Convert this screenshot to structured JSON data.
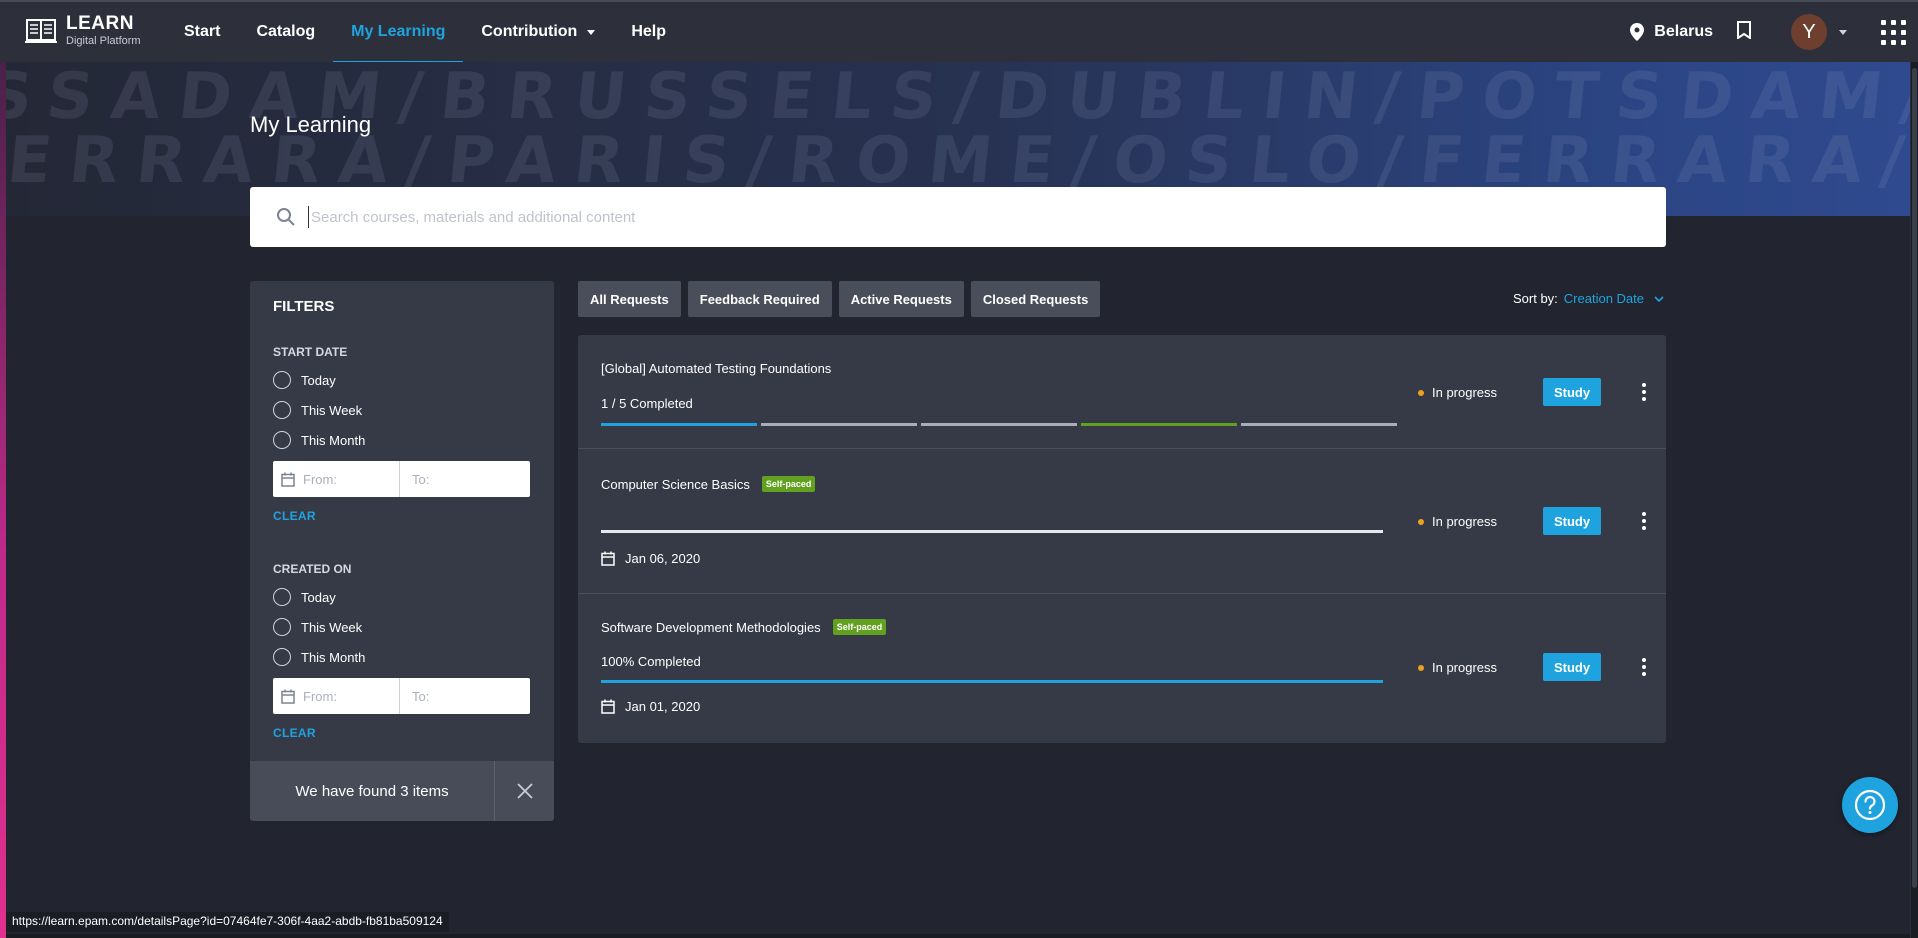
{
  "header": {
    "logo_title": "LEARN",
    "logo_subtitle": "Digital Platform",
    "nav": [
      {
        "label": "Start"
      },
      {
        "label": "Catalog"
      },
      {
        "label": "My Learning",
        "active": true
      },
      {
        "label": "Contribution",
        "dropdown": true
      },
      {
        "label": "Help"
      }
    ],
    "location": "Belarus",
    "avatar_initial": "Y",
    "accent_color": "#1fa3de"
  },
  "banner": {
    "row1": "SSADAM/BRUSSELS/DUBLIN/POTSDAM/BRUSSELS/DUBLIN",
    "row2": "FERRARA/PARIS/ROME/OSLO/FERRARA/PARIS/ROME"
  },
  "page": {
    "title": "My Learning"
  },
  "search": {
    "placeholder": "Search courses, materials and additional content",
    "value": ""
  },
  "filters": {
    "title": "FILTERS",
    "start_date": {
      "label": "START DATE",
      "options": [
        "Today",
        "This Week",
        "This Month"
      ],
      "from_placeholder": "From:",
      "to_placeholder": "To:",
      "clear": "CLEAR"
    },
    "created_on": {
      "label": "CREATED ON",
      "options": [
        "Today",
        "This Week",
        "This Month"
      ],
      "from_placeholder": "From:",
      "to_placeholder": "To:",
      "clear": "CLEAR"
    },
    "found_text": "We have found 3 items"
  },
  "tabs": [
    "All Requests",
    "Feedback Required",
    "Active Requests",
    "Closed Requests"
  ],
  "sort": {
    "label": "Sort by:",
    "value": "Creation Date"
  },
  "results": [
    {
      "title": "[Global] Automated Testing Foundations",
      "progress_text": "1 / 5 Completed",
      "segments": [
        "done",
        "todo",
        "todo",
        "current",
        "todo"
      ],
      "status": "In progress",
      "action": "Study"
    },
    {
      "title": "Computer Science Basics",
      "badge": "Self-paced",
      "progress": 0,
      "date": "Jan 06, 2020",
      "status": "In progress",
      "action": "Study"
    },
    {
      "title": "Software Development Methodologies",
      "badge": "Self-paced",
      "progress_text": "100% Completed",
      "progress": 1,
      "date": "Jan 01, 2020",
      "status": "In progress",
      "action": "Study"
    }
  ],
  "statusbar": {
    "url": "https://learn.epam.com/detailsPage?id=07464fe7-306f-4aa2-abdb-fb81ba509124"
  },
  "colors": {
    "segment_done": "#1fa3de",
    "segment_current": "#62a01f",
    "segment_todo": "#a9adb7",
    "status_dot": "#f0a020"
  }
}
